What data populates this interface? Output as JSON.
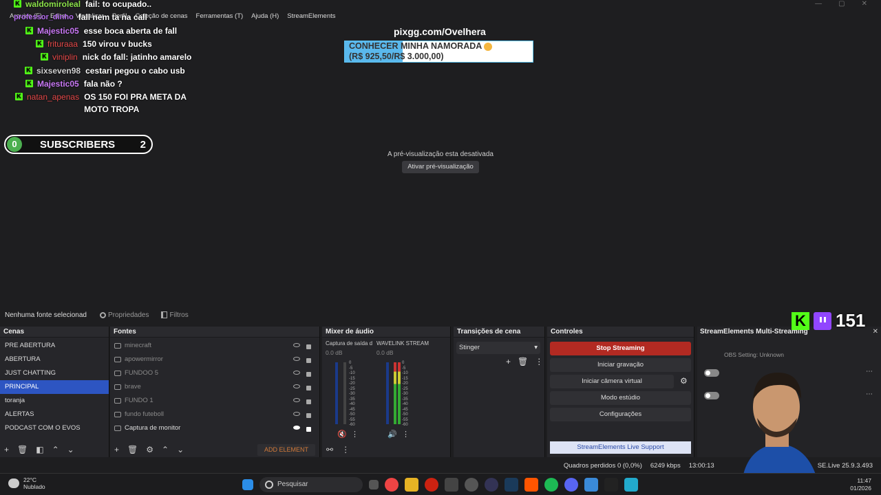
{
  "menubar": {
    "items": [
      "Arquivo (F)",
      "Editar",
      "Visualizar",
      "Perfil",
      "Coleção de cenas",
      "Ferramentas (T)",
      "Ajuda (H)",
      "StreamElements"
    ]
  },
  "chat": {
    "messages": [
      {
        "user": "waldomiroleal",
        "msg": "fail: to ocupado..",
        "color": "#8ce34a",
        "k": true
      },
      {
        "user": "professor_dinho",
        "msg": "fall nem ta na call",
        "color": "#b56cf0",
        "k": false
      },
      {
        "user": "Majestic05",
        "msg": "esse boca aberta de fall",
        "color": "#c978f5",
        "k": true
      },
      {
        "user": "frituraaa",
        "msg": "150 virou v bucks",
        "color": "#e84a4a",
        "k": true
      },
      {
        "user": "viniplin",
        "msg": "nick do fall: jatinho amarelo",
        "color": "#e84a4a",
        "k": true
      },
      {
        "user": "sixseven98",
        "msg": "cestari pegou o cabo usb",
        "color": "#d0d0d0",
        "k": true
      },
      {
        "user": "Majestic05",
        "msg": "fala não ?",
        "color": "#c978f5",
        "k": true
      },
      {
        "user": "natan_apenas",
        "msg": "OS 150 FOI PRA META DA",
        "msg2": "MOTO TROPA",
        "color": "#e84a4a",
        "k": true
      }
    ]
  },
  "subs": {
    "left": "0",
    "label": "SUBSCRIBERS",
    "count": "2"
  },
  "pix": "pixgg.com/Ovelhera",
  "goal": {
    "line1": "CONHECER MINHA NAMORADA",
    "line2": "(R$ 925,50/R$ 3.000,00)",
    "current": 925.5,
    "target": 3000
  },
  "preview": {
    "message": "A pré-visualização esta desativada",
    "button": "Ativar pré-visualização"
  },
  "sourcebar": {
    "none": "Nenhuma fonte selecionad",
    "properties": "Propriedades",
    "filters": "Filtros"
  },
  "scenes": {
    "title": "Cenas",
    "items": [
      "PRE ABERTURA",
      "ABERTURA",
      "JUST CHATTING",
      "PRINCIPAL",
      "toranja",
      "ALERTAS",
      "PODCAST COM O EVOS"
    ],
    "selected": 3
  },
  "sources": {
    "title": "Fontes",
    "items": [
      "minecraft",
      "apowermirror",
      "FUNDOO 5",
      "brave",
      "FUNDO 1",
      "fundo futeboll",
      "Captura de monitor"
    ],
    "add": "ADD ELEMENT"
  },
  "mixer": {
    "title": "Mixer de áudio",
    "ch1": "Captura de saída d",
    "ch2": "WAVELINK STREAM",
    "db": "0.0 dB",
    "scale": [
      "0",
      "-5",
      "-10",
      "-15",
      "-20",
      "-25",
      "-30",
      "-35",
      "-40",
      "-45",
      "-50",
      "-55",
      "-60"
    ]
  },
  "transitions": {
    "title": "Transições de cena",
    "selected": "Stinger"
  },
  "controls": {
    "title": "Controles",
    "buttons": [
      "Stop Streaming",
      "Iniciar gravação",
      "Iniciar câmera virtual",
      "Modo estúdio",
      "Configurações"
    ],
    "support": "StreamElements Live Support"
  },
  "multistream": {
    "title": "StreamElements Multi-Streaming",
    "obs": "OBS Setting: Unknown"
  },
  "viewers": {
    "count": "151"
  },
  "status": {
    "dropped": "Quadros perdidos 0 (0,0%)",
    "kbps": "6249 kbps",
    "time": "13:00:13",
    "version": "SE.Live 25.9.3.493"
  },
  "taskbar": {
    "temp": "22°C",
    "weather": "Nublado",
    "search": "Pesquisar",
    "time": "11:47",
    "date": "01/2026"
  },
  "colors": {
    "accent": "#2d55c2",
    "stop": "#b22a22",
    "kick": "#53fc18",
    "twitch": "#9146ff"
  }
}
